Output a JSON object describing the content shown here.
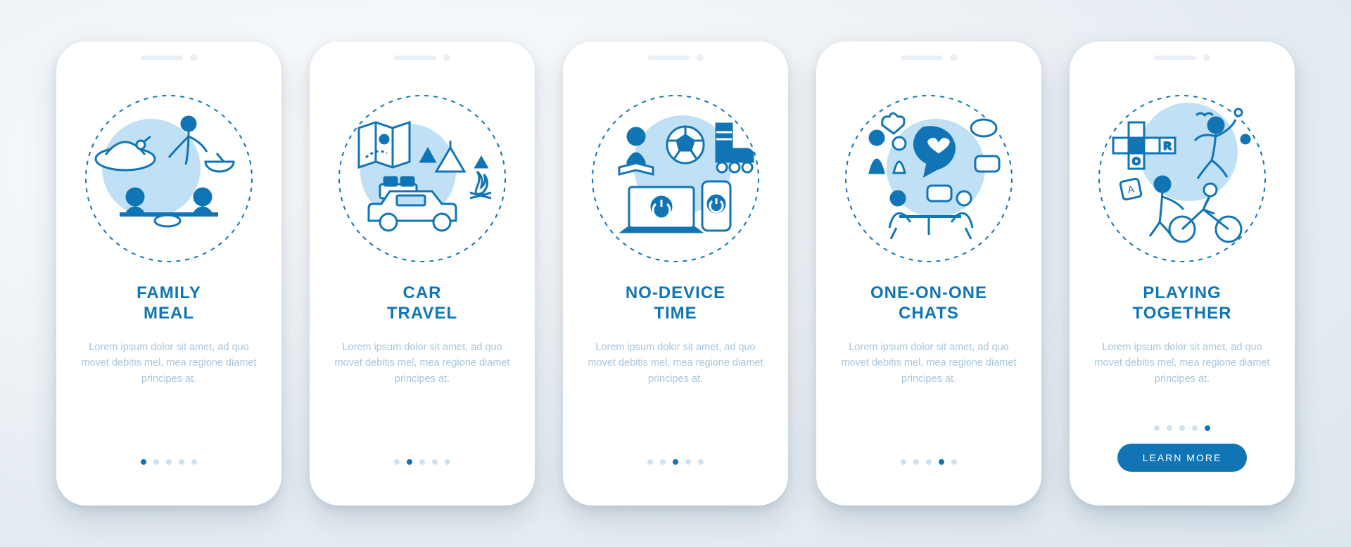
{
  "colors": {
    "accent": "#1175b5",
    "muted": "#a8c5d9",
    "dotInactive": "#cfe2ef",
    "phoneBg": "#ffffff"
  },
  "screens": [
    {
      "title": "FAMILY\nMEAL",
      "description": "Lorem ipsum dolor sit amet, ad quo movet debitis mel, mea regione diamet principes at.",
      "illustration": "family-meal-icon"
    },
    {
      "title": "CAR\nTRAVEL",
      "description": "Lorem ipsum dolor sit amet, ad quo movet debitis mel, mea regione diamet principes at.",
      "illustration": "car-travel-icon"
    },
    {
      "title": "NO-DEVICE\nTIME",
      "description": "Lorem ipsum dolor sit amet, ad quo movet debitis mel, mea regione diamet principes at.",
      "illustration": "no-device-time-icon"
    },
    {
      "title": "ONE-ON-ONE\nCHATS",
      "description": "Lorem ipsum dolor sit amet, ad quo movet debitis mel, mea regione diamet principes at.",
      "illustration": "one-on-one-chats-icon"
    },
    {
      "title": "PLAYING\nTOGETHER",
      "description": "Lorem ipsum dolor sit amet, ad quo movet debitis mel, mea regione diamet principes at.",
      "illustration": "playing-together-icon"
    }
  ],
  "cta": {
    "label": "LEARN MORE",
    "visibleOnScreenIndex": 4
  },
  "dotsCount": 5
}
